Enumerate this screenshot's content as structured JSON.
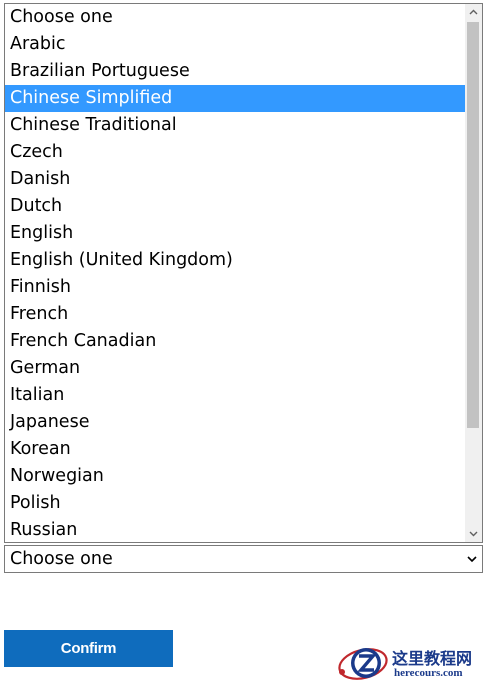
{
  "listbox": {
    "selected_index": 3,
    "options": [
      "Choose one",
      "Arabic",
      "Brazilian Portuguese",
      "Chinese Simplified",
      "Chinese Traditional",
      "Czech",
      "Danish",
      "Dutch",
      "English",
      "English (United Kingdom)",
      "Finnish",
      "French",
      "French Canadian",
      "German",
      "Italian",
      "Japanese",
      "Korean",
      "Norwegian",
      "Polish",
      "Russian"
    ],
    "selection_color": "#3399ff"
  },
  "select": {
    "value": "Choose one",
    "icon": "chevron-down-icon"
  },
  "confirm": {
    "label": "Confirm",
    "color": "#0f6cbd"
  },
  "watermark": {
    "title": "这里教程网",
    "url": "herecours.com",
    "color": "#1b3a8a"
  }
}
